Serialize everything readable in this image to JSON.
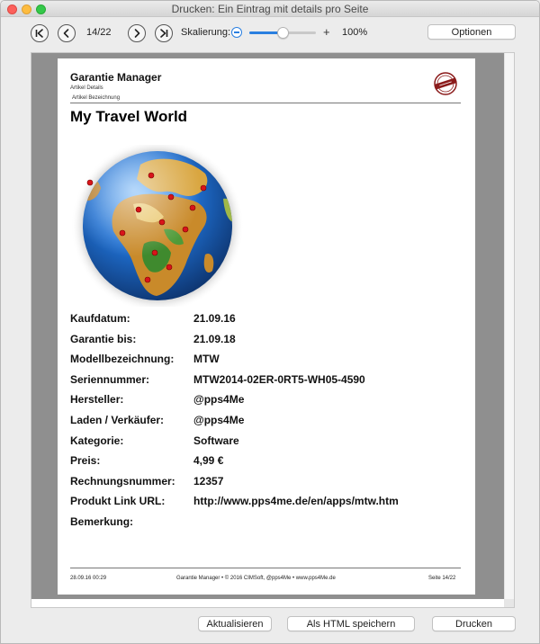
{
  "window": {
    "title": "Drucken: Ein Eintrag mit details pro Seite"
  },
  "toolbar": {
    "page_counter": "14/22",
    "scale_label": "Skalierung:",
    "zoom_value": "100%",
    "zoom_level_percent": 100,
    "options_button": "Optionen"
  },
  "page": {
    "app_name": "Garantie Manager",
    "header_subtitle": "Artikel Details",
    "header_column": "Artikel Bezeichnung",
    "logo_text": "CIMSoft",
    "item_title": "My Travel World",
    "details": [
      {
        "label": "Kaufdatum:",
        "value": "21.09.16"
      },
      {
        "label": "Garantie bis:",
        "value": "21.09.18"
      },
      {
        "label": "Modellbezeichnung:",
        "value": "MTW"
      },
      {
        "label": "Seriennummer:",
        "value": "MTW2014-02ER-0RT5-WH05-4590"
      },
      {
        "label": "Hersteller:",
        "value": "@pps4Me"
      },
      {
        "label": "Laden / Verkäufer:",
        "value": "@pps4Me"
      },
      {
        "label": "Kategorie:",
        "value": "Software"
      },
      {
        "label": "Preis:",
        "value": "4,99 €"
      },
      {
        "label": "Rechnungsnummer:",
        "value": "12357"
      },
      {
        "label": "Produkt Link URL:",
        "value": "http://www.pps4me.de/en/apps/mtw.htm"
      },
      {
        "label": "Bemerkung:",
        "value": ""
      }
    ],
    "footer": {
      "date": "28.09.16 00:29",
      "center": "Garantie Manager  •  © 2016 CIMSoft, @pps4Me  •  www.pps4Me.de",
      "page": "Seite 14/22"
    }
  },
  "buttons": {
    "refresh": "Aktualisieren",
    "save_html": "Als HTML speichern",
    "print": "Drucken"
  },
  "colors": {
    "accent": "#2a7fe0"
  }
}
